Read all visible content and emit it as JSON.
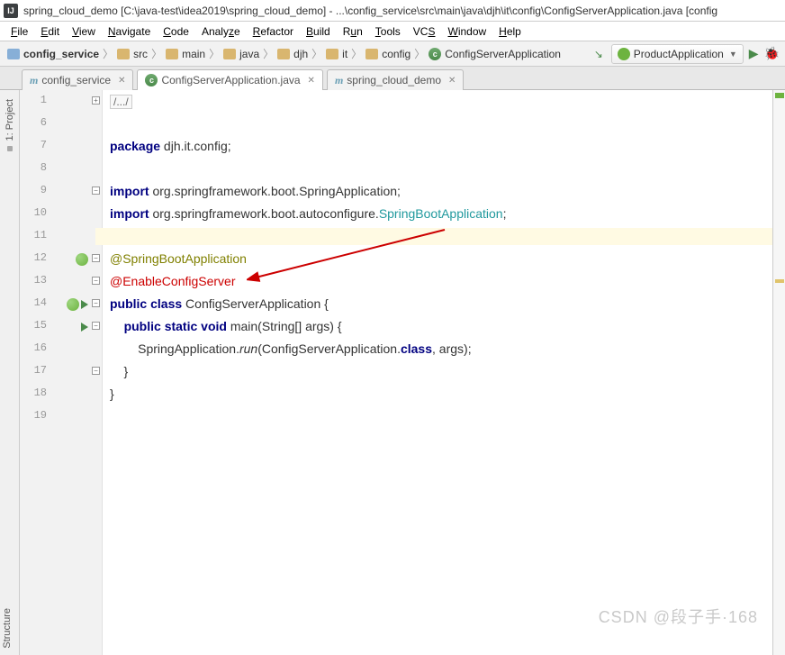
{
  "title": "spring_cloud_demo [C:\\java-test\\idea2019\\spring_cloud_demo] - ...\\config_service\\src\\main\\java\\djh\\it\\config\\ConfigServerApplication.java [config",
  "menus": [
    "File",
    "Edit",
    "View",
    "Navigate",
    "Code",
    "Analyze",
    "Refactor",
    "Build",
    "Run",
    "Tools",
    "VCS",
    "Window",
    "Help"
  ],
  "breadcrumbs": [
    {
      "label": "config_service",
      "type": "module",
      "bold": true
    },
    {
      "label": "src",
      "type": "folder"
    },
    {
      "label": "main",
      "type": "folder"
    },
    {
      "label": "java",
      "type": "folder"
    },
    {
      "label": "djh",
      "type": "folder"
    },
    {
      "label": "it",
      "type": "folder"
    },
    {
      "label": "config",
      "type": "folder"
    },
    {
      "label": "ConfigServerApplication",
      "type": "class"
    }
  ],
  "run_config": "ProductApplication",
  "tabs": [
    {
      "label": "config_service",
      "icon": "m",
      "active": false
    },
    {
      "label": "ConfigServerApplication.java",
      "icon": "c",
      "active": true
    },
    {
      "label": "spring_cloud_demo",
      "icon": "m",
      "active": false
    }
  ],
  "side_tool_left_top": "1: Project",
  "side_tool_left_bottom": "Structure",
  "code": {
    "folded": "/.../",
    "l7": {
      "kw": "package",
      "rest": " djh.it.config;"
    },
    "l9": {
      "kw": "import",
      "rest": " org.springframework.boot.SpringApplication;"
    },
    "l10": {
      "kw": "import",
      "p1": " org.springframework.boot.autoconfigure.",
      "type": "SpringBootApplication",
      "p2": ";"
    },
    "l12": "@SpringBootApplication",
    "l13": "@EnableConfigServer",
    "l14": {
      "kw1": "public",
      "kw2": "class",
      "name": " ConfigServerApplication {"
    },
    "l15": {
      "kw1": "public",
      "kw2": "static",
      "kw3": "void",
      "sig": " main(String[] args) {"
    },
    "l16": {
      "p1": "SpringApplication.",
      "m": "run",
      "p2": "(ConfigServerApplication.",
      "kw": "class",
      "p3": ", args);"
    },
    "l17": "    }",
    "l18": "}"
  },
  "line_numbers": [
    1,
    6,
    7,
    8,
    9,
    10,
    11,
    12,
    13,
    14,
    15,
    16,
    17,
    18,
    19
  ],
  "watermark": "CSDN @段子手·168"
}
